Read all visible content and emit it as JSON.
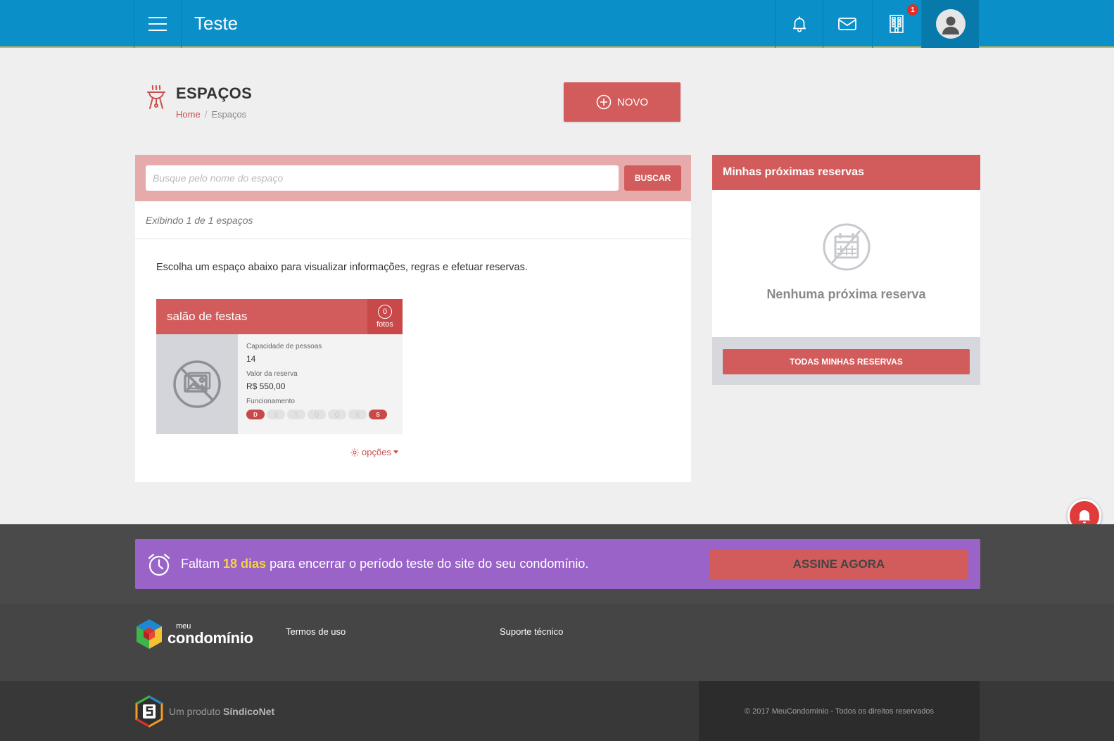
{
  "header": {
    "title": "Teste",
    "building_badge": "1",
    "icons": [
      "menu-icon",
      "bell-icon",
      "mail-icon",
      "building-icon",
      "user-avatar-icon"
    ]
  },
  "page": {
    "title": "ESPAÇOS",
    "breadcrumb": {
      "home": "Home",
      "separator": "/",
      "current": "Espaços"
    },
    "new_button": "NOVO"
  },
  "search": {
    "placeholder": "Busque pelo nome do espaço",
    "value": "",
    "button": "BUSCAR"
  },
  "results": {
    "count_text": "Exibindo 1 de 1 espaços",
    "instructions": "Escolha um espaço abaixo para visualizar informações, regras e efetuar reservas."
  },
  "spaces": [
    {
      "name": "salão de festas",
      "photos_count": "0",
      "photos_label": "fotos",
      "capacity_label": "Capacidade de pessoas",
      "capacity_value": "14",
      "price_label": "Valor da reserva",
      "price_value": "R$ 550,00",
      "hours_label": "Funcionamento",
      "days": [
        {
          "label": "D",
          "active": true
        },
        {
          "label": "S",
          "active": false
        },
        {
          "label": "T",
          "active": false
        },
        {
          "label": "Q",
          "active": false
        },
        {
          "label": "Q",
          "active": false
        },
        {
          "label": "S",
          "active": false
        },
        {
          "label": "S",
          "active": true
        }
      ]
    }
  ],
  "options_link": "opções",
  "reservations_panel": {
    "title": "Minhas próximas reservas",
    "empty_text": "Nenhuma próxima reserva",
    "button": "TODAS MINHAS RESERVAS"
  },
  "trial_banner": {
    "prefix": "Faltam",
    "highlight": "18 dias",
    "suffix": "para encerrar o período teste do site do seu condomínio.",
    "button": "ASSINE AGORA"
  },
  "footer": {
    "logo_small": "meu",
    "logo_main": "condomínio",
    "links": {
      "terms": "Termos de uso",
      "support": "Suporte técnico"
    },
    "product_prefix": "Um produto",
    "product_name": "SíndicoNet",
    "copyright": "© 2017 MeuCondomínio - Todos os direitos reservados"
  },
  "colors": {
    "topbar": "#0a8fc8",
    "accent": "#d25c5c",
    "trial": "#9963c8",
    "highlight": "#f6d243"
  }
}
